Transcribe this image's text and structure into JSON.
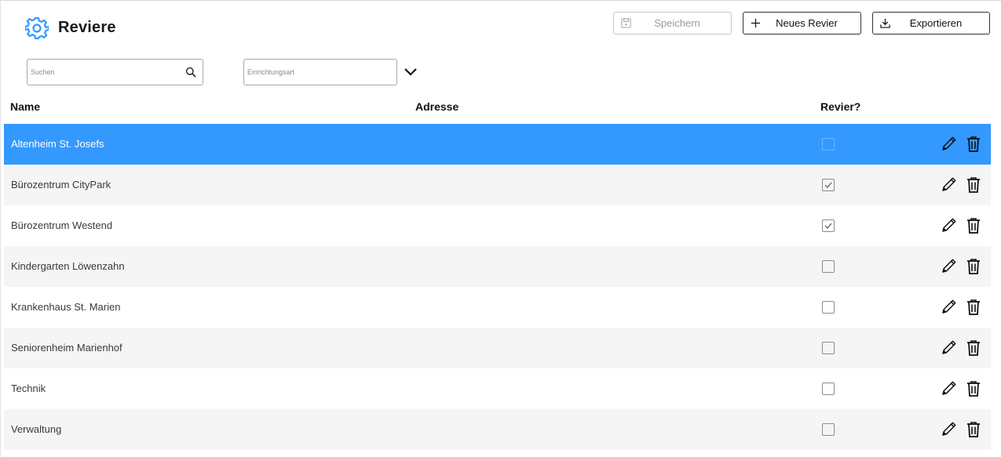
{
  "header": {
    "title": "Reviere",
    "icon": "gear-icon",
    "accent_color": "#3399ff"
  },
  "toolbar": {
    "save_label": "Speichern",
    "save_icon": "floppy-disk-icon",
    "new_label": "Neues Revier",
    "new_icon": "plus-icon",
    "export_label": "Exportieren",
    "export_icon": "download-icon"
  },
  "filters": {
    "search_placeholder": "Suchen",
    "search_value": "",
    "type_placeholder": "Einrichtungsart",
    "type_value": ""
  },
  "table": {
    "columns": [
      "Name",
      "Adresse",
      "Revier?"
    ],
    "selected_row_color": "#3399ff",
    "rows": [
      {
        "name": "Altenheim St. Josefs",
        "address": "",
        "revier": false,
        "selected": true
      },
      {
        "name": "Bürozentrum CityPark",
        "address": "",
        "revier": true,
        "selected": false
      },
      {
        "name": "Bürozentrum Westend",
        "address": "",
        "revier": true,
        "selected": false
      },
      {
        "name": "Kindergarten Löwenzahn",
        "address": "",
        "revier": false,
        "selected": false
      },
      {
        "name": "Krankenhaus St. Marien",
        "address": "",
        "revier": false,
        "selected": false
      },
      {
        "name": "Seniorenheim Marienhof",
        "address": "",
        "revier": false,
        "selected": false
      },
      {
        "name": "Technik",
        "address": "",
        "revier": false,
        "selected": false
      },
      {
        "name": "Verwaltung",
        "address": "",
        "revier": false,
        "selected": false
      }
    ]
  }
}
